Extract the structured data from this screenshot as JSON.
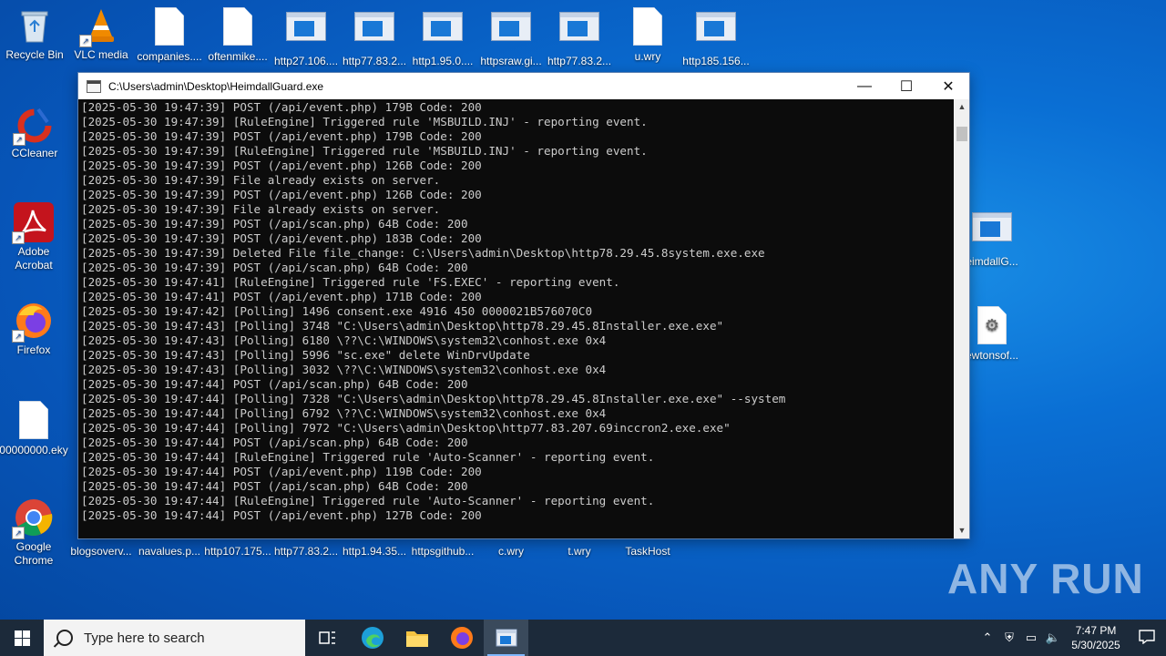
{
  "desktop": {
    "top_row": [
      {
        "label": "Recycle Bin",
        "icon": "recycle-bin-icon"
      },
      {
        "label": "VLC media",
        "icon": "vlc-icon"
      },
      {
        "label": "companies....",
        "icon": "file-icon"
      },
      {
        "label": "oftenmike....",
        "icon": "file-icon"
      },
      {
        "label": "http27.106....",
        "icon": "window-icon"
      },
      {
        "label": "http77.83.2...",
        "icon": "window-icon"
      },
      {
        "label": "http1.95.0....",
        "icon": "window-icon"
      },
      {
        "label": "httpsraw.gi...",
        "icon": "window-icon"
      },
      {
        "label": "http77.83.2...",
        "icon": "window-icon"
      },
      {
        "label": "u.wry",
        "icon": "file-icon"
      },
      {
        "label": "http185.156...",
        "icon": "window-icon"
      }
    ],
    "left_col": [
      {
        "label": "CCleaner",
        "icon": "ccleaner-icon"
      },
      {
        "label": "Adobe Acrobat",
        "icon": "acrobat-icon"
      },
      {
        "label": "Firefox",
        "icon": "firefox-icon"
      },
      {
        "label": "00000000.eky",
        "icon": "file-icon"
      },
      {
        "label": "Google Chrome",
        "icon": "chrome-icon"
      }
    ],
    "bottom_row": [
      {
        "label": "blogsoverv..."
      },
      {
        "label": "navalues.p..."
      },
      {
        "label": "http107.175..."
      },
      {
        "label": "http77.83.2..."
      },
      {
        "label": "http1.94.35..."
      },
      {
        "label": "httpsgithub..."
      },
      {
        "label": "c.wry"
      },
      {
        "label": "t.wry"
      },
      {
        "label": "TaskHost"
      }
    ],
    "right_col": [
      {
        "label": "eimdallG...",
        "icon": "window-icon"
      },
      {
        "label": "ewtonsof...",
        "icon": "settings-file-icon"
      }
    ]
  },
  "window": {
    "title": "C:\\Users\\admin\\Desktop\\HeimdallGuard.exe",
    "minimize": "—",
    "maximize": "☐",
    "close": "✕",
    "console_lines": [
      "[2025-05-30 19:47:39] POST (/api/event.php) 179B Code: 200",
      "[2025-05-30 19:47:39] [RuleEngine] Triggered rule 'MSBUILD.INJ' - reporting event.",
      "[2025-05-30 19:47:39] POST (/api/event.php) 179B Code: 200",
      "[2025-05-30 19:47:39] [RuleEngine] Triggered rule 'MSBUILD.INJ' - reporting event.",
      "[2025-05-30 19:47:39] POST (/api/event.php) 126B Code: 200",
      "[2025-05-30 19:47:39] File already exists on server.",
      "[2025-05-30 19:47:39] POST (/api/event.php) 126B Code: 200",
      "[2025-05-30 19:47:39] File already exists on server.",
      "[2025-05-30 19:47:39] POST (/api/scan.php) 64B Code: 200",
      "[2025-05-30 19:47:39] POST (/api/event.php) 183B Code: 200",
      "[2025-05-30 19:47:39] Deleted File file_change: C:\\Users\\admin\\Desktop\\http78.29.45.8system.exe.exe",
      "[2025-05-30 19:47:39] POST (/api/scan.php) 64B Code: 200",
      "[2025-05-30 19:47:41] [RuleEngine] Triggered rule 'FS.EXEC' - reporting event.",
      "[2025-05-30 19:47:41] POST (/api/event.php) 171B Code: 200",
      "[2025-05-30 19:47:42] [Polling] 1496 consent.exe 4916 450 0000021B576070C0",
      "[2025-05-30 19:47:43] [Polling] 3748 \"C:\\Users\\admin\\Desktop\\http78.29.45.8Installer.exe.exe\"",
      "[2025-05-30 19:47:43] [Polling] 6180 \\??\\C:\\WINDOWS\\system32\\conhost.exe 0x4",
      "[2025-05-30 19:47:43] [Polling] 5996 \"sc.exe\" delete WinDrvUpdate",
      "[2025-05-30 19:47:43] [Polling] 3032 \\??\\C:\\WINDOWS\\system32\\conhost.exe 0x4",
      "[2025-05-30 19:47:44] POST (/api/scan.php) 64B Code: 200",
      "[2025-05-30 19:47:44] [Polling] 7328 \"C:\\Users\\admin\\Desktop\\http78.29.45.8Installer.exe.exe\" --system",
      "[2025-05-30 19:47:44] [Polling] 6792 \\??\\C:\\WINDOWS\\system32\\conhost.exe 0x4",
      "[2025-05-30 19:47:44] [Polling] 7972 \"C:\\Users\\admin\\Desktop\\http77.83.207.69inccron2.exe.exe\"",
      "[2025-05-30 19:47:44] POST (/api/scan.php) 64B Code: 200",
      "[2025-05-30 19:47:44] [RuleEngine] Triggered rule 'Auto-Scanner' - reporting event.",
      "[2025-05-30 19:47:44] POST (/api/event.php) 119B Code: 200",
      "[2025-05-30 19:47:44] POST (/api/scan.php) 64B Code: 200",
      "[2025-05-30 19:47:44] [RuleEngine] Triggered rule 'Auto-Scanner' - reporting event.",
      "[2025-05-30 19:47:44] POST (/api/event.php) 127B Code: 200"
    ]
  },
  "taskbar": {
    "search_placeholder": "Type here to search",
    "time": "7:47 PM",
    "date": "5/30/2025"
  },
  "watermark": "ANY RUN"
}
